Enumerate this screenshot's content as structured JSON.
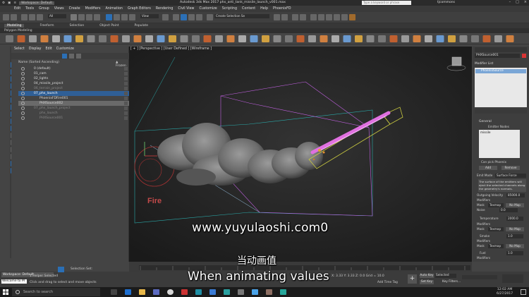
{
  "title_bar": {
    "menu_icons": [
      "⚙",
      "▣",
      "≡"
    ],
    "workspace": "Workspace: Default",
    "app_title": "Autodesk 3ds Max 2017    phx_anti_tank_missile_launch_v001.max",
    "search_placeholder": "Type a keyword or phrase",
    "user": "tjcommons"
  },
  "menu": [
    "Edit",
    "Tools",
    "Group",
    "Views",
    "Create",
    "Modifiers",
    "Animation",
    "Graph Editors",
    "Rendering",
    "Civil View",
    "Customize",
    "Scripting",
    "Content",
    "Help",
    "PhoenixFD"
  ],
  "toolbar": {
    "filter": "All",
    "view": "View",
    "create_selection_set": "Create Selection Se"
  },
  "ribbon": {
    "tabs": [
      "Modeling",
      "Freeform",
      "Selection",
      "Object Paint",
      "Populate"
    ],
    "active_tab": "Modeling",
    "sub": "Polygon Modeling"
  },
  "scene_explorer": {
    "tabs": [
      "Select",
      "Display",
      "Edit",
      "Customize"
    ],
    "header_name": "Name (Sorted Ascending)",
    "header_frozen": "▲ Frozen",
    "rows": [
      {
        "label": "0 (default)",
        "state": "normal"
      },
      {
        "label": "01_cam",
        "state": "normal"
      },
      {
        "label": "02_lights",
        "state": "normal"
      },
      {
        "label": "04_missile_project",
        "state": "normal"
      },
      {
        "label": "06_terrain_project",
        "state": "dim"
      },
      {
        "label": "07_phx_launch",
        "state": "selected"
      },
      {
        "label": "PhoenixFDFire001",
        "state": "normal"
      },
      {
        "label": "PHXSource002",
        "state": "highlight"
      },
      {
        "label": "07_phx_launch_project",
        "state": "dim"
      },
      {
        "label": "phx_launch",
        "state": "dim"
      },
      {
        "label": "PHXSource001",
        "state": "dim"
      }
    ]
  },
  "viewport": {
    "label": "[ + ] [Perspective ] [User Defined ] [Wireframe ]",
    "fire_label": "Fire"
  },
  "command_panel": {
    "object_name": "PHXSource001",
    "modifier_list": "Modifier List",
    "stack_item": "PhoenixSource",
    "general": "General",
    "emitter_nodes": "Emitter Nodes",
    "emitter_item": "missile",
    "can_pick": "Can pick Phoenix",
    "add": "Add",
    "remove": "Remove",
    "emit_mode_label": "Emit Mode",
    "emit_mode_value": "Surface Force",
    "description": "The surface of the emitters will eject the selected channels along the geometry's normals.",
    "outgoing_label": "Outgoing Velocity",
    "outgoing_value": "85000.0",
    "modifiers": "Modifiers",
    "mask": "Mask",
    "texmap": "Texmap",
    "no_map": "No Map",
    "noise_label": "Noise",
    "noise_value": "0.0",
    "temperature_label": "Temperature",
    "temperature_value": "2000.0",
    "smoke_label": "Smoke",
    "smoke_value": "1.0",
    "fuel_label": "Fuel",
    "fuel_value": "1.0"
  },
  "status": {
    "workspace": "Workspace: Default",
    "selection_set": "Selection Set:",
    "helper": "1 Helper Selected",
    "hint": "Click and drag to select and move objects",
    "maxscript": "Welcome to M",
    "coords": "X: 3.33   Y: 3.33   Z: 0.0   Grid = 10.0",
    "auto_key": "Auto Key",
    "set_key": "Set Key",
    "selected": "Selected",
    "key_filters": "Key Filters...",
    "add_time_tag": "Add Time Tag",
    "timeline_label": "0 / 100"
  },
  "taskbar": {
    "search_placeholder": "Search to search",
    "time": "12:02 AM",
    "date": "6/27/2017"
  },
  "subtitles": {
    "url": "www.yuyulaoshi.com0",
    "zh": "当动画值",
    "en": "When animating values"
  }
}
